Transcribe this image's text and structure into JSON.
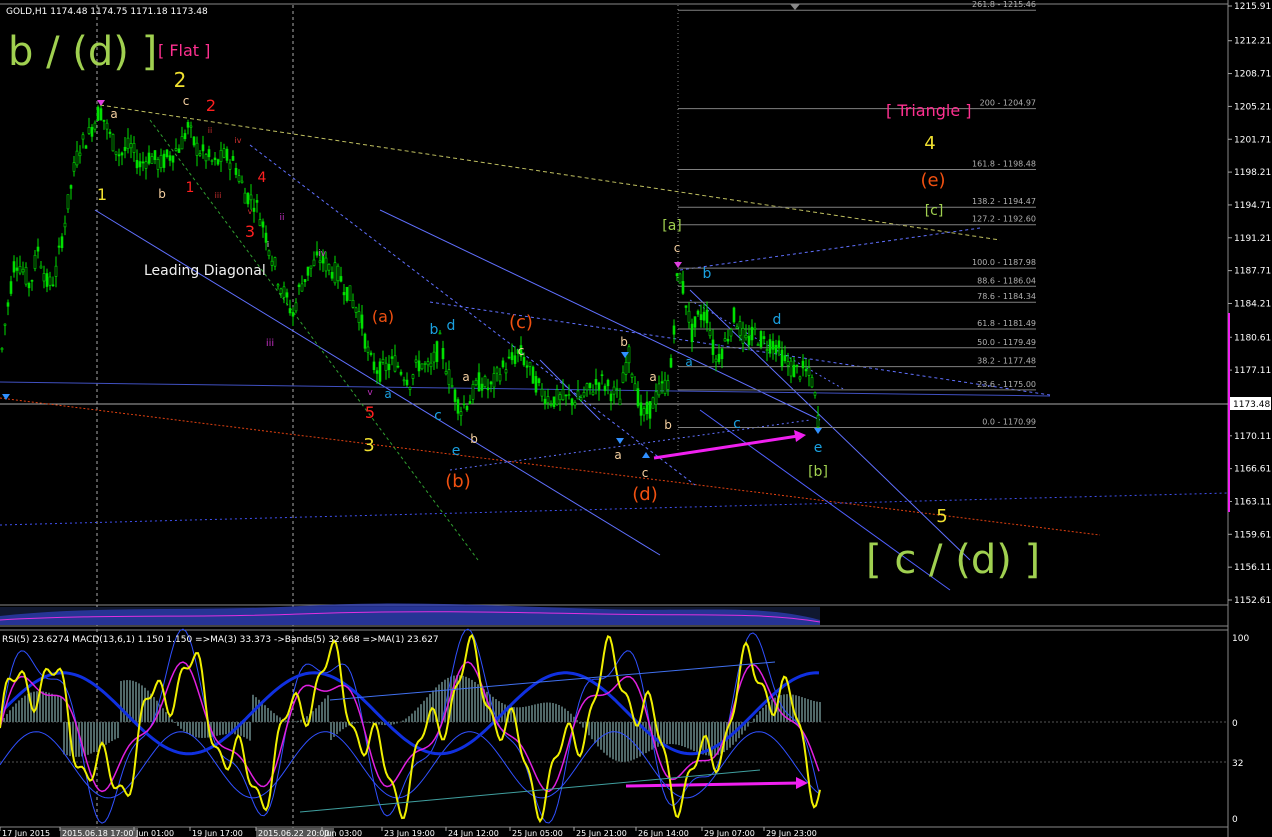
{
  "header": {
    "symbol_line": "GOLD,H1  1174.48 1174.75 1171.18 1173.48"
  },
  "indicator": {
    "header_line": "RSI(5) 23.6274  MACD(13,6,1) 1.150 1.150  =>MA(3) 33.373  ->Bands(5) 32.668  =>MA(1) 23.627",
    "scale_labels": [
      "100",
      "0",
      "32",
      "0"
    ]
  },
  "price_axis": {
    "labels": [
      "1215.91",
      "1212.21",
      "1208.71",
      "1205.21",
      "1201.71",
      "1198.21",
      "1194.71",
      "1191.21",
      "1187.71",
      "1184.21",
      "1180.61",
      "1177.11",
      "1173.48",
      "1170.11",
      "1166.61",
      "1163.11",
      "1159.61",
      "1156.11",
      "1152.61"
    ],
    "current": "1173.48"
  },
  "time_axis": {
    "labels": [
      "17 Jun 2015",
      "2015.06.18 17:00",
      "Jun 01:00",
      "19 Jun 17:00",
      "2015.06.22 20:00",
      "Jun 03:00",
      "23 Jun 19:00",
      "24 Jun 12:00",
      "25 Jun 05:00",
      "25 Jun 21:00",
      "26 Jun 14:00",
      "29 Jun 07:00",
      "29 Jun 23:00"
    ]
  },
  "fib_levels": [
    "0.0 - 1170.99",
    "23.6 - 1175.00",
    "38.2 - 1177.48",
    "50.0 - 1179.49",
    "61.8 - 1181.49",
    "78.6 - 1184.34",
    "88.6 - 1186.04",
    "100.0 - 1187.98",
    "127.2 - 1192.60",
    "138.2 - 1194.47",
    "161.8 - 1198.48",
    "200 - 1204.97",
    "261.8 - 1215.46"
  ],
  "annotations": {
    "big_b_d": "b / (d) ]",
    "flat": "[ Flat ]",
    "leading_diagonal": "Leading Diagonal",
    "triangle": "[ Triangle ]",
    "big_c_d": "[ c / (d) ]",
    "wave_labels": [
      {
        "t": "2",
        "c": "#f0e030"
      },
      {
        "t": "c",
        "c": "#f5d0a0"
      },
      {
        "t": "2",
        "c": "#ff2020"
      },
      {
        "t": "a",
        "c": "#f5d0a0"
      },
      {
        "t": "1",
        "c": "#f0e030"
      },
      {
        "t": "b",
        "c": "#f5d0a0"
      },
      {
        "t": "1",
        "c": "#ff2020"
      },
      {
        "t": "ii",
        "c": "#d03030"
      },
      {
        "t": "iii",
        "c": "#d03030"
      },
      {
        "t": "iv",
        "c": "#d03030"
      },
      {
        "t": "4",
        "c": "#ff2020"
      },
      {
        "t": "v",
        "c": "#d03030"
      },
      {
        "t": "3",
        "c": "#ff2020"
      },
      {
        "t": "i",
        "c": "#f0f0f0"
      },
      {
        "t": "ii",
        "c": "#c030c0"
      },
      {
        "t": "iii",
        "c": "#c030c0"
      },
      {
        "t": "iv",
        "c": "#c030c0"
      },
      {
        "t": "v",
        "c": "#c030c0"
      },
      {
        "t": "(a)",
        "c": "#f05010"
      },
      {
        "t": "5",
        "c": "#ff2020"
      },
      {
        "t": "3",
        "c": "#f0e030"
      },
      {
        "t": "a",
        "c": "#1aa0e0"
      },
      {
        "t": "b",
        "c": "#1aa0e0"
      },
      {
        "t": "d",
        "c": "#1aa0e0"
      },
      {
        "t": "c",
        "c": "#1aa0e0"
      },
      {
        "t": "e",
        "c": "#1aa0e0"
      },
      {
        "t": "a",
        "c": "#f5d0a0"
      },
      {
        "t": "b",
        "c": "#f5d0a0"
      },
      {
        "t": "(b)",
        "c": "#f05010"
      },
      {
        "t": "(c)",
        "c": "#f05010"
      },
      {
        "t": "c",
        "c": "#f5d0a0"
      },
      {
        "t": "b",
        "c": "#f5d0a0"
      },
      {
        "t": "a",
        "c": "#f5d0a0"
      },
      {
        "t": "b",
        "c": "#f5d0a0"
      },
      {
        "t": "a",
        "c": "#f5d0a0"
      },
      {
        "t": "c",
        "c": "#f5d0a0"
      },
      {
        "t": "(d)",
        "c": "#f05010"
      },
      {
        "t": "[a]",
        "c": "#a0d050"
      },
      {
        "t": "c",
        "c": "#f5d0a0"
      },
      {
        "t": "b",
        "c": "#1aa0e0"
      },
      {
        "t": "a",
        "c": "#1aa0e0"
      },
      {
        "t": "c",
        "c": "#1aa0e0"
      },
      {
        "t": "d",
        "c": "#1aa0e0"
      },
      {
        "t": "e",
        "c": "#1aa0e0"
      },
      {
        "t": "[b]",
        "c": "#a0d050"
      },
      {
        "t": "4",
        "c": "#f0e030"
      },
      {
        "t": "(e)",
        "c": "#f05010"
      },
      {
        "t": "[c]",
        "c": "#a0d050"
      },
      {
        "t": "5",
        "c": "#f0e030"
      }
    ]
  },
  "colors": {
    "bull": "#00e000",
    "bear": "#00e000",
    "fib": "#808080",
    "rsi": "#f0f000",
    "ma": "#e020e0",
    "bands": "#4060ff",
    "macd": "#506060",
    "magenta_arrow": "#f020f0",
    "lime_text": "#a0d050"
  },
  "chart_data": {
    "type": "candlestick",
    "ylim": [
      1152.61,
      1215.91
    ],
    "description_points": [
      [
        0,
        1177.5
      ],
      [
        5,
        1182
      ],
      [
        15,
        1189
      ],
      [
        22,
        1188
      ],
      [
        30,
        1186
      ],
      [
        38,
        1190
      ],
      [
        48,
        1186
      ],
      [
        55,
        1187
      ],
      [
        65,
        1193
      ],
      [
        75,
        1199
      ],
      [
        80,
        1201
      ],
      [
        88,
        1202
      ],
      [
        96,
        1204
      ],
      [
        100,
        1205
      ],
      [
        110,
        1202
      ],
      [
        120,
        1200
      ],
      [
        130,
        1201
      ],
      [
        140,
        1199
      ],
      [
        150,
        1200
      ],
      [
        160,
        1199
      ],
      [
        170,
        1200
      ],
      [
        180,
        1201
      ],
      [
        188,
        1203
      ],
      [
        195,
        1201
      ],
      [
        205,
        1200
      ],
      [
        215,
        1199
      ],
      [
        225,
        1200
      ],
      [
        235,
        1199
      ],
      [
        245,
        1196
      ],
      [
        255,
        1195
      ],
      [
        262,
        1193
      ],
      [
        270,
        1190
      ],
      [
        278,
        1187
      ],
      [
        285,
        1185
      ],
      [
        293,
        1183
      ],
      [
        300,
        1186
      ],
      [
        310,
        1188
      ],
      [
        320,
        1189
      ],
      [
        330,
        1188
      ],
      [
        340,
        1187
      ],
      [
        350,
        1185
      ],
      [
        360,
        1183
      ],
      [
        370,
        1178
      ],
      [
        380,
        1177
      ],
      [
        395,
        1178
      ],
      [
        410,
        1176
      ],
      [
        420,
        1178
      ],
      [
        430,
        1177
      ],
      [
        440,
        1180
      ],
      [
        450,
        1176
      ],
      [
        460,
        1173
      ],
      [
        470,
        1174
      ],
      [
        480,
        1176
      ],
      [
        490,
        1175
      ],
      [
        500,
        1177
      ],
      [
        510,
        1178
      ],
      [
        520,
        1179
      ],
      [
        530,
        1177
      ],
      [
        540,
        1175
      ],
      [
        550,
        1174
      ],
      [
        560,
        1174
      ],
      [
        570,
        1174
      ],
      [
        580,
        1174
      ],
      [
        590,
        1175
      ],
      [
        600,
        1176
      ],
      [
        610,
        1175
      ],
      [
        620,
        1174
      ],
      [
        628,
        1179
      ],
      [
        635,
        1176
      ],
      [
        642,
        1172
      ],
      [
        650,
        1173
      ],
      [
        660,
        1175
      ],
      [
        670,
        1176
      ],
      [
        678,
        1188
      ],
      [
        685,
        1185
      ],
      [
        692,
        1181
      ],
      [
        700,
        1183
      ],
      [
        708,
        1183
      ],
      [
        715,
        1178
      ],
      [
        725,
        1180
      ],
      [
        735,
        1183
      ],
      [
        745,
        1180
      ],
      [
        755,
        1181
      ],
      [
        765,
        1180
      ],
      [
        775,
        1180
      ],
      [
        785,
        1178
      ],
      [
        795,
        1177
      ],
      [
        805,
        1177
      ],
      [
        812,
        1176
      ],
      [
        818,
        1172
      ]
    ]
  }
}
